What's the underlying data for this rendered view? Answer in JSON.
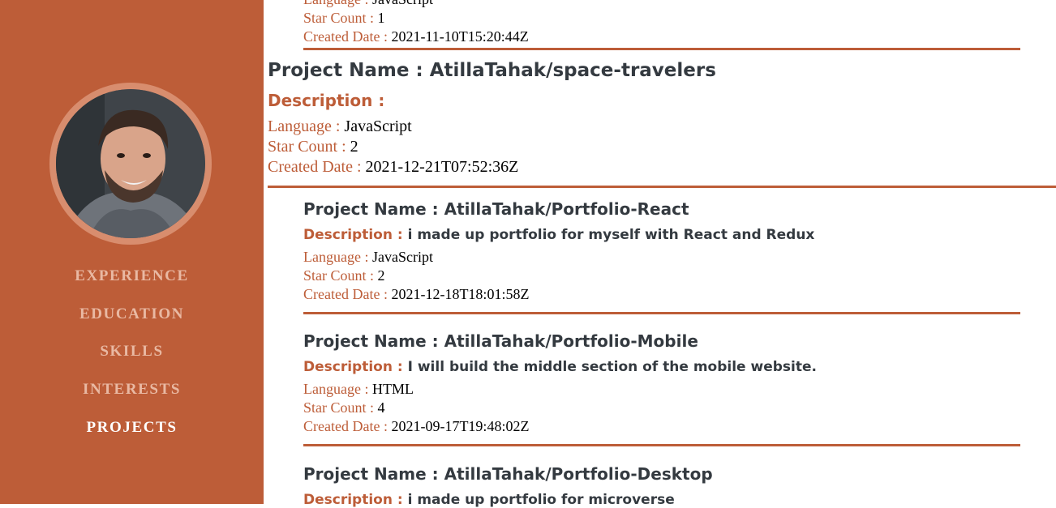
{
  "sidebar": {
    "avatar_alt": "Profile photo",
    "nav": [
      {
        "label": "EXPERIENCE",
        "active": false
      },
      {
        "label": "EDUCATION",
        "active": false
      },
      {
        "label": "SKILLS",
        "active": false
      },
      {
        "label": "INTERESTS",
        "active": false
      },
      {
        "label": "PROJECTS",
        "active": true
      }
    ]
  },
  "labels": {
    "project_name": "Project Name :",
    "description": "Description :",
    "language": "Language :",
    "star_count": "Star Count :",
    "created_date": "Created Date :"
  },
  "projects": [
    {
      "name": "",
      "description": "",
      "language": "JavaScript",
      "stars": "1",
      "created": "2021-11-10T15:20:44Z"
    },
    {
      "name": "AtillaTahak/space-travelers",
      "description": "",
      "language": "JavaScript",
      "stars": "2",
      "created": "2021-12-21T07:52:36Z"
    },
    {
      "name": "AtillaTahak/Portfolio-React",
      "description": "i made up portfolio for myself with React and Redux",
      "language": "JavaScript",
      "stars": "2",
      "created": "2021-12-18T18:01:58Z"
    },
    {
      "name": "AtillaTahak/Portfolio-Mobile",
      "description": "I will build the middle section of the mobile website.",
      "language": "HTML",
      "stars": "4",
      "created": "2021-09-17T19:48:02Z"
    },
    {
      "name": "AtillaTahak/Portfolio-Desktop",
      "description": "i made up portfolio for microverse",
      "language": "",
      "stars": "",
      "created": ""
    }
  ],
  "colors": {
    "accent": "#bd5d38",
    "sidebar_text": "#e9b9a3",
    "heading": "#343a40"
  }
}
